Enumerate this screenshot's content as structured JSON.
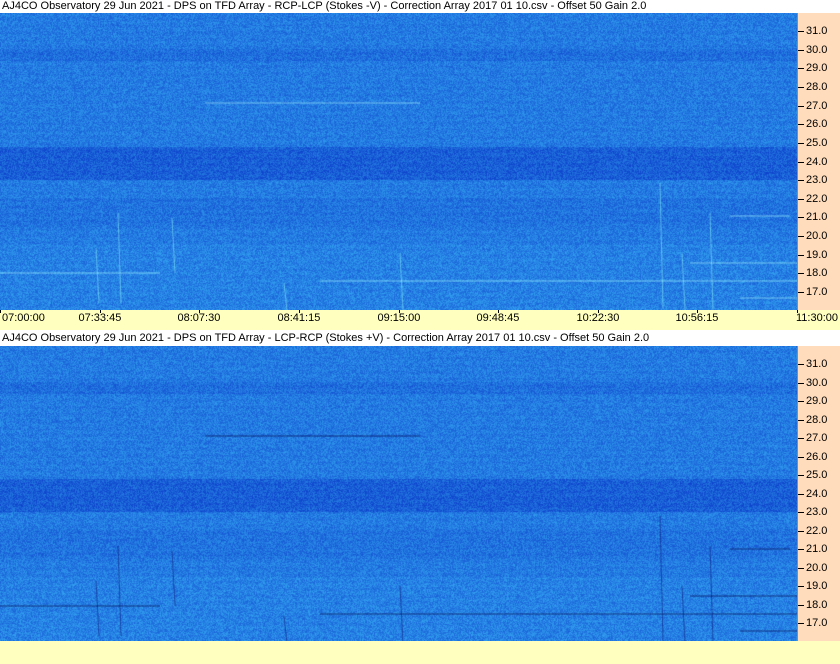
{
  "panels": [
    {
      "title": "AJ4CO Observatory 29 Jun 2021  -  DPS on TFD Array  -  RCP-LCP (Stokes -V)  -  Correction Array 2017 01 10.csv  -  Offset 50  Gain 2.0",
      "polarity": "RCP-LCP",
      "y_labels": [
        "31.0",
        "30.0",
        "29.0",
        "28.0",
        "27.0",
        "26.0",
        "25.0",
        "24.0",
        "23.0",
        "22.0",
        "21.0",
        "20.0",
        "19.0",
        "18.0",
        "17.0"
      ],
      "x_labels": [
        "07:00:00",
        "07:33:45",
        "08:07:30",
        "08:41:15",
        "09:15:00",
        "09:48:45",
        "10:22:30",
        "10:56:15",
        "11:30:00"
      ]
    },
    {
      "title": "AJ4CO Observatory 29 Jun 2021  -  DPS on TFD Array  -  LCP-RCP (Stokes +V)  -  Correction Array 2017 01 10.csv  -  Offset 50  Gain 2.0",
      "polarity": "LCP-RCP",
      "y_labels": [
        "31.0",
        "30.0",
        "29.0",
        "28.0",
        "27.0",
        "26.0",
        "25.0",
        "24.0",
        "23.0",
        "22.0",
        "21.0",
        "20.0",
        "19.0",
        "18.0",
        "17.0"
      ],
      "x_labels": []
    }
  ],
  "colors": {
    "spectrogram_base": "#1e6ae6",
    "y_axis_bg": "#ffdcbb",
    "x_axis_bg": "#ffffc0"
  }
}
